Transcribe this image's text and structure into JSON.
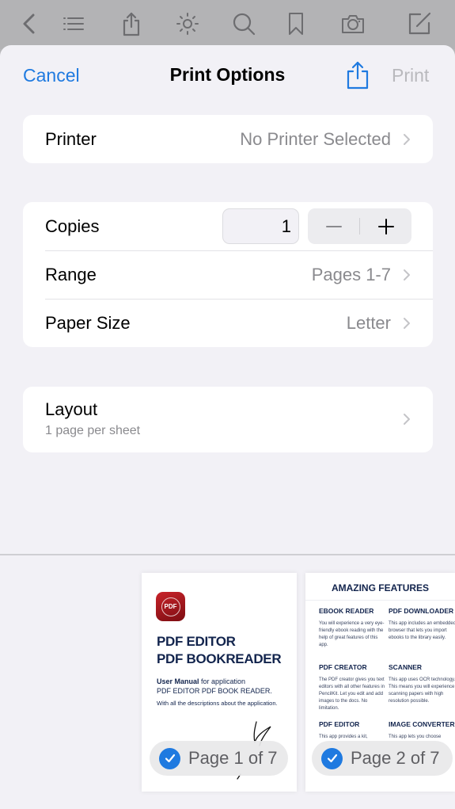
{
  "toolbar": {
    "icons": [
      "back-chevron",
      "list",
      "share",
      "brightness",
      "search",
      "bookmark",
      "camera",
      "compose"
    ]
  },
  "nav": {
    "cancel_label": "Cancel",
    "title": "Print Options",
    "print_label": "Print"
  },
  "printer": {
    "label": "Printer",
    "value": "No Printer Selected"
  },
  "copies": {
    "label": "Copies",
    "value": "1",
    "decrement_label": "−",
    "increment_label": "+"
  },
  "range": {
    "label": "Range",
    "value": "Pages 1-7"
  },
  "paper_size": {
    "label": "Paper Size",
    "value": "Letter"
  },
  "layout": {
    "label": "Layout",
    "subtitle": "1 page per sheet"
  },
  "previews": [
    {
      "page_label": "Page 1 of 7",
      "selected": true,
      "icon_text": "PDF",
      "title_line1": "PDF EDITOR",
      "title_line2": "PDF BOOKREADER",
      "manual_bold": "User Manual",
      "manual_rest": " for application",
      "manual_line2": "PDF EDITOR PDF BOOK READER.",
      "description": "With all the descriptions about the application."
    },
    {
      "page_label": "Page 2 of 7",
      "selected": true,
      "heading": "AMAZING FEATURES",
      "features": [
        {
          "title": "EBOOK READER",
          "text": "You will experience a very eye-friendly ebook reading with the help of great features of this app."
        },
        {
          "title": "PDF DOWNLOADER",
          "text": "This app includes an embedded browser that lets you import ebooks to the library easily."
        },
        {
          "title": "PDF CREATOR",
          "text": "The PDF creator gives you text editors with all other features in PencilKit. Let you edit and add images to the docs. No limitation."
        },
        {
          "title": "SCANNER",
          "text": "This app uses OCR technology. This means you will experience scanning papers with high resolution possible."
        },
        {
          "title": "PDF EDITOR",
          "text": "This app provides a kit,"
        },
        {
          "title": "IMAGE CONVERTER",
          "text": "This app lets you choose"
        }
      ]
    }
  ],
  "colors": {
    "accent": "#1f7ae0",
    "disabled": "#b9b9bd",
    "secondary_text": "#8a8a8e",
    "sheet_bg": "#f2f1f6"
  }
}
